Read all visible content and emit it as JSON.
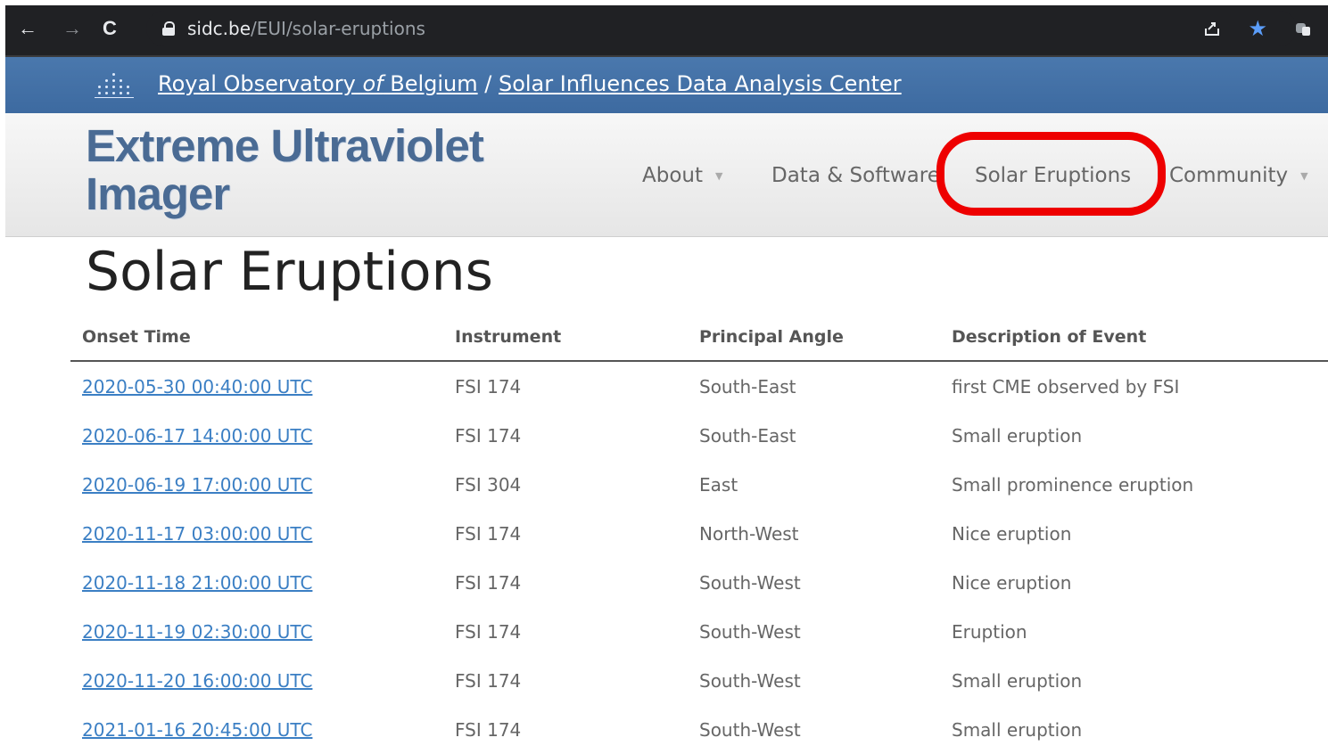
{
  "browser": {
    "url_host": "sidc.be",
    "url_path": "/EUI/solar-eruptions",
    "back_icon": "←",
    "forward_icon": "→",
    "reload_icon": "C"
  },
  "banner": {
    "royal_observatory": "Royal Observatory ",
    "of": "of",
    "belgium": " Belgium",
    "separator": " / ",
    "sidc": "Solar Influences Data Analysis Center"
  },
  "header": {
    "title_line1": "Extreme Ultraviolet",
    "title_line2": "Imager",
    "menu": {
      "about": "About",
      "data_software": "Data & Software",
      "solar_eruptions": "Solar Eruptions",
      "community": "Community"
    },
    "highlight_color": "#ee0000"
  },
  "page": {
    "title": "Solar Eruptions",
    "columns": [
      "Onset Time",
      "Instrument",
      "Principal Angle",
      "Description of Event"
    ],
    "rows": [
      {
        "onset": "2020-05-30 00:40:00 UTC",
        "instrument": "FSI 174",
        "angle": "South-East",
        "description": "first CME observed by FSI"
      },
      {
        "onset": "2020-06-17 14:00:00 UTC",
        "instrument": "FSI 174",
        "angle": "South-East",
        "description": "Small eruption"
      },
      {
        "onset": "2020-06-19 17:00:00 UTC",
        "instrument": "FSI 304",
        "angle": "East",
        "description": "Small prominence eruption"
      },
      {
        "onset": "2020-11-17 03:00:00 UTC",
        "instrument": "FSI 174",
        "angle": "North-West",
        "description": "Nice eruption"
      },
      {
        "onset": "2020-11-18 21:00:00 UTC",
        "instrument": "FSI 174",
        "angle": "South-West",
        "description": "Nice eruption"
      },
      {
        "onset": "2020-11-19 02:30:00 UTC",
        "instrument": "FSI 174",
        "angle": "South-West",
        "description": "Eruption"
      },
      {
        "onset": "2020-11-20 16:00:00 UTC",
        "instrument": "FSI 174",
        "angle": "South-West",
        "description": "Small eruption"
      },
      {
        "onset": "2021-01-16 20:45:00 UTC",
        "instrument": "FSI 174",
        "angle": "South-West",
        "description": "Small eruption"
      }
    ]
  }
}
